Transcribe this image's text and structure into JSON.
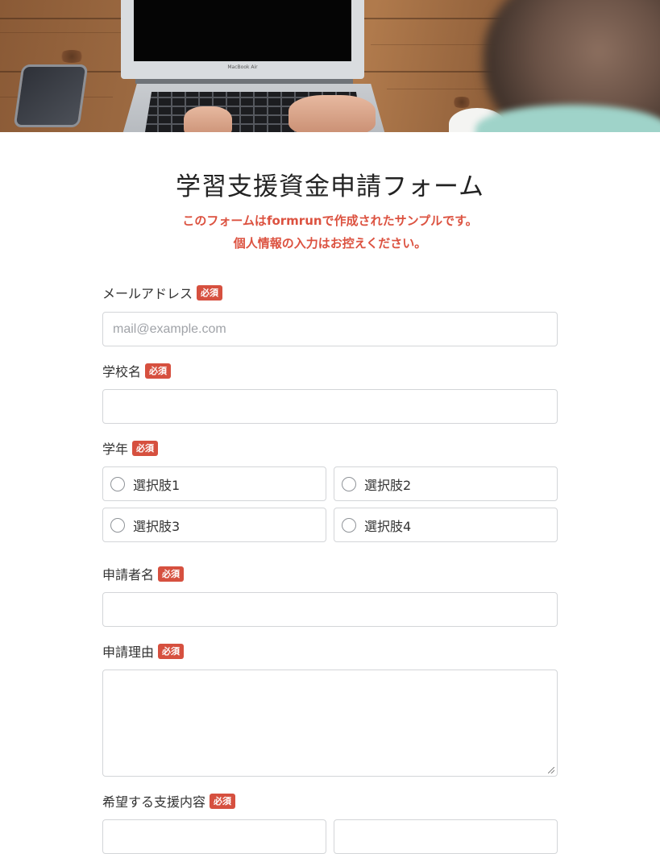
{
  "header_image": {
    "laptop_brand": "MacBook Air"
  },
  "form": {
    "title": "学習支援資金申請フォーム",
    "notice": {
      "line1_prefix": "このフォームは",
      "line1_brand": "formrun",
      "line1_suffix": "で作成されたサンプルです。",
      "line2": "個人情報の入力はお控えください。"
    },
    "required_label": "必須",
    "fields": {
      "email": {
        "label": "メールアドレス",
        "placeholder": "mail@example.com",
        "value": ""
      },
      "school": {
        "label": "学校名",
        "value": ""
      },
      "grade": {
        "label": "学年",
        "options": [
          "選択肢1",
          "選択肢2",
          "選択肢3",
          "選択肢4"
        ]
      },
      "applicant": {
        "label": "申請者名",
        "value": ""
      },
      "reason": {
        "label": "申請理由",
        "value": ""
      },
      "support": {
        "label": "希望する支援内容"
      }
    }
  },
  "colors": {
    "accent": "#dc5240",
    "badge": "#d6503f",
    "border": "#d3d5d8",
    "text": "#333333"
  }
}
